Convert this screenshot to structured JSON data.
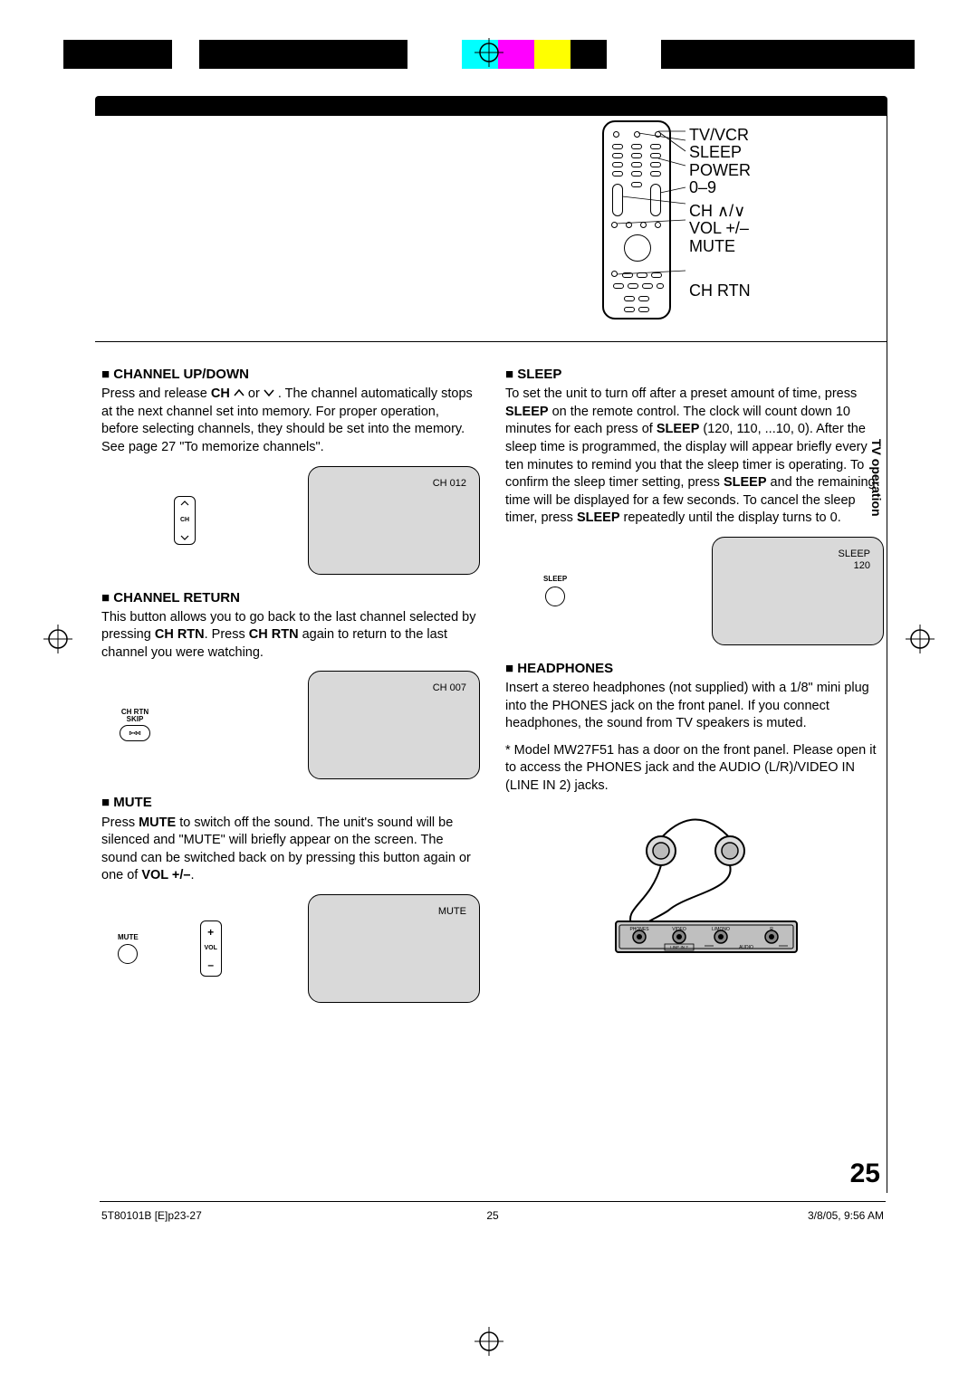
{
  "remote_labels": {
    "l1": "TV/VCR",
    "l2": "SLEEP",
    "l3": "POWER",
    "l4": "0–9",
    "l5": "CH ∧/∨",
    "l6": "VOL +/–",
    "l7": "MUTE",
    "l8": "CH RTN"
  },
  "left_col": {
    "ch_updown": {
      "title": "CHANNEL UP/DOWN",
      "text1": "Press and release ",
      "bold1": "CH ",
      "text2": " or ",
      "text3": ". The channel automatically stops at the next channel set into memory. For proper operation, before selecting channels, they should be set into the memory. See page 27 \"To memorize channels\".",
      "osd": "CH 012",
      "ch_label": "CH"
    },
    "ch_return": {
      "title": "CHANNEL RETURN",
      "text1": "This button allows you to go back to the last channel selected by pressing ",
      "bold1": "CH RTN",
      "text2": ". Press ",
      "bold2": "CH RTN",
      "text3": " again to return to the last channel you were watching.",
      "osd": "CH 007",
      "btn_label": "CH RTN\nSKIP",
      "btn_glyph": "▹◃◃"
    },
    "mute": {
      "title": "MUTE",
      "text1": "Press ",
      "bold1": "MUTE",
      "text2": " to switch off the sound. The unit's sound will be silenced and \"MUTE\" will briefly appear on the screen. The sound can be switched back on by pressing this button again or one of ",
      "bold2": "VOL +/–",
      "text3": ".",
      "osd": "MUTE",
      "btn_label": "MUTE",
      "vol_label": "VOL"
    }
  },
  "right_col": {
    "sleep": {
      "title": "SLEEP",
      "text1": "To set the unit to turn off after a preset amount of time, press ",
      "bold1": "SLEEP",
      "text2": " on the remote control. The clock will count down 10 minutes for each press of ",
      "bold2": "SLEEP",
      "text3": " (120, 110, ...10, 0). After the sleep time is programmed, the display will appear briefly every ten minutes to remind you that the sleep timer is operating. To confirm the sleep timer setting, press ",
      "bold3": "SLEEP",
      "text4": " and the remaining time will be displayed for a few seconds. To cancel the sleep timer, press ",
      "bold4": "SLEEP",
      "text5": " repeatedly until the display turns to 0.",
      "osd1": "SLEEP",
      "osd2": "120",
      "btn_label": "SLEEP"
    },
    "headphones": {
      "title": "HEADPHONES",
      "text1": "Insert a stereo headphones (not supplied) with a 1/8\" mini plug into the PHONES jack on the front panel. If you connect headphones, the sound from TV speakers is muted.",
      "note": "* Model MW27F51 has a door on the front panel. Please open it to access the PHONES jack and the AUDIO (L/R)/VIDEO IN (LINE IN 2) jacks."
    }
  },
  "side_tab": "TV operation",
  "page_number": "25",
  "footer": {
    "left": "5T80101B [E]p23-27",
    "center": "25",
    "right": "3/8/05, 9:56 AM"
  }
}
